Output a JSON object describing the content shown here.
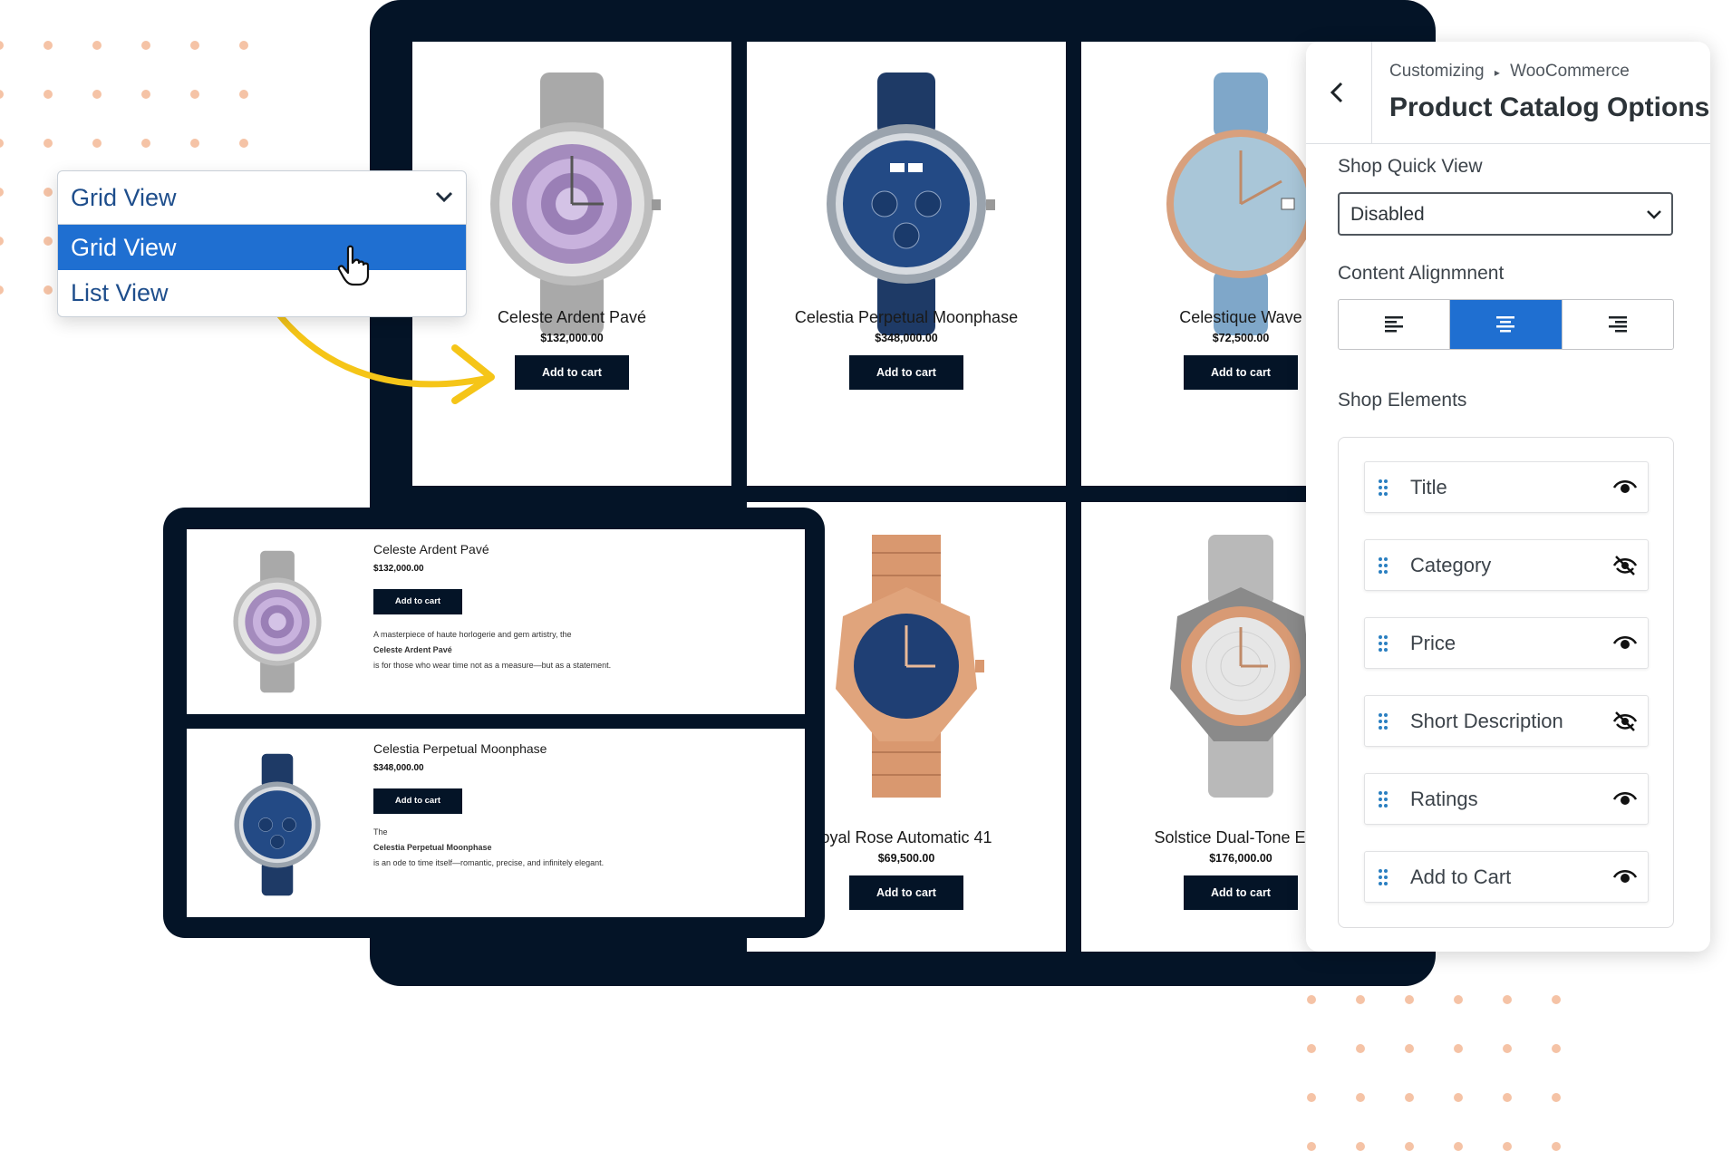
{
  "view_dropdown": {
    "selected": "Grid View",
    "options": [
      "Grid View",
      "List View"
    ]
  },
  "grid_products": [
    {
      "name": "Celeste Ardent Pavé",
      "price": "$132,000.00",
      "button": "Add to cart"
    },
    {
      "name": "Celestia Perpetual Moonphase",
      "price": "$348,000.00",
      "button": "Add to cart"
    },
    {
      "name": "Celestique Wave",
      "price": "$72,500.00",
      "button": "Add to cart"
    },
    {
      "name": "oyal Rose Automatic 41",
      "price": "$69,500.00",
      "button": "Add to cart"
    },
    {
      "name": "Solstice Dual-Tone Eleg",
      "price": "$176,000.00",
      "button": "Add to cart"
    }
  ],
  "list_products": [
    {
      "name": "Celeste Ardent Pavé",
      "price": "$132,000.00",
      "button": "Add to cart",
      "desc_before": "A masterpiece of haute horlogerie and gem artistry, the",
      "desc_bold": "Celeste Ardent Pavé",
      "desc_after": "is for those who wear time not as a measure—but as a statement."
    },
    {
      "name": "Celestia Perpetual Moonphase",
      "price": "$348,000.00",
      "button": "Add to cart",
      "desc_before": "The",
      "desc_bold": "Celestia Perpetual Moonphase",
      "desc_after": "is an ode to time itself—romantic, precise, and infinitely elegant."
    }
  ],
  "customizer": {
    "breadcrumb_root": "Customizing",
    "breadcrumb_sep": "▸",
    "breadcrumb_section": "WooCommerce",
    "title": "Product Catalog Options",
    "quick_view_label": "Shop Quick View",
    "quick_view_value": "Disabled",
    "alignment_label": "Content Alignmnent",
    "alignment_selected": "center",
    "elements_label": "Shop Elements",
    "elements": [
      {
        "name": "Title",
        "visible": true
      },
      {
        "name": "Category",
        "visible": false
      },
      {
        "name": "Price",
        "visible": true
      },
      {
        "name": "Short Description",
        "visible": false
      },
      {
        "name": "Ratings",
        "visible": true
      },
      {
        "name": "Add to Cart",
        "visible": true
      }
    ]
  },
  "colors": {
    "navy": "#041427",
    "accent_blue": "#1f6fd1",
    "arrow_yellow": "#f5c518",
    "dot_peach": "#f5c3a6"
  }
}
